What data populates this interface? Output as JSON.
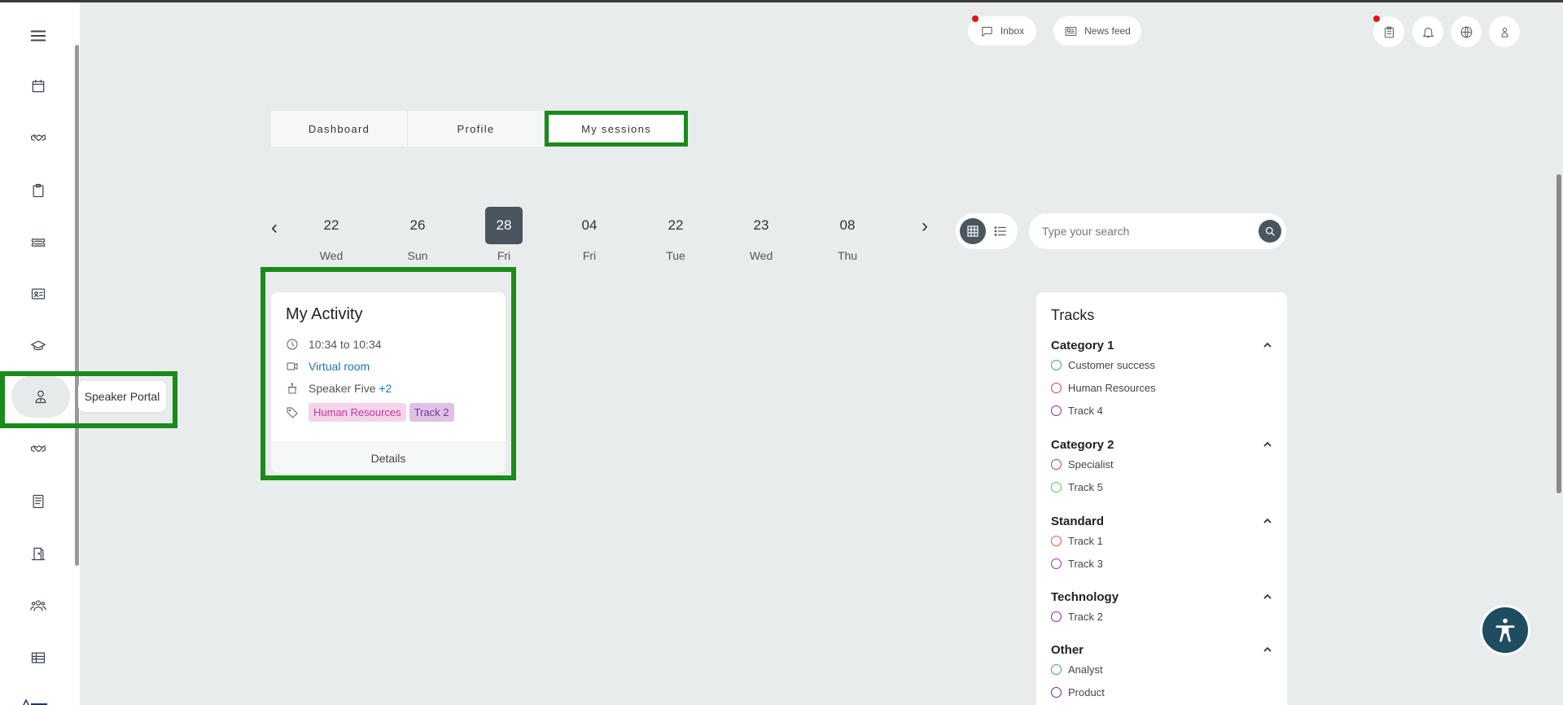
{
  "header": {
    "inbox_label": "Inbox",
    "newsfeed_label": "News feed"
  },
  "sidebar": {
    "items": [
      {
        "icon": "menu-icon"
      },
      {
        "icon": "calendar-icon"
      },
      {
        "icon": "handshake-icon"
      },
      {
        "icon": "clipboard-icon"
      },
      {
        "icon": "ticket-icon"
      },
      {
        "icon": "id-card-icon"
      },
      {
        "icon": "graduation-cap-icon"
      },
      {
        "icon": "speaker-icon",
        "active": true
      },
      {
        "icon": "handshake-icon"
      },
      {
        "icon": "book-icon"
      },
      {
        "icon": "door-icon"
      },
      {
        "icon": "group-icon"
      },
      {
        "icon": "table-icon"
      }
    ],
    "tooltip": "Speaker Portal"
  },
  "tabs": [
    {
      "label": "Dashboard"
    },
    {
      "label": "Profile"
    },
    {
      "label": "My sessions",
      "active": true
    }
  ],
  "dates": [
    {
      "num": "22",
      "day": "Wed"
    },
    {
      "num": "26",
      "day": "Sun"
    },
    {
      "num": "28",
      "day": "Fri",
      "active": true
    },
    {
      "num": "04",
      "day": "Fri"
    },
    {
      "num": "22",
      "day": "Tue"
    },
    {
      "num": "23",
      "day": "Wed"
    },
    {
      "num": "08",
      "day": "Thu"
    }
  ],
  "search": {
    "placeholder": "Type your search"
  },
  "activity": {
    "title": "My Activity",
    "time": "10:34 to 10:34",
    "location": "Virtual room",
    "speaker": "Speaker Five",
    "speaker_extra": "+2",
    "tags": [
      "Human Resources",
      "Track 2"
    ],
    "footer": "Details"
  },
  "tracks": {
    "title": "Tracks",
    "categories": [
      {
        "name": "Category 1",
        "items": [
          {
            "label": "Customer success",
            "color": "#3cb043"
          },
          {
            "label": "Human Resources",
            "color": "#c23a95"
          },
          {
            "label": "Track 4",
            "color": "#7a3294"
          }
        ]
      },
      {
        "name": "Category 2",
        "items": [
          {
            "label": "Specialist",
            "color": "#b03ab0"
          },
          {
            "label": "Track 5",
            "color": "#5cc25c"
          }
        ]
      },
      {
        "name": "Standard",
        "items": [
          {
            "label": "Track 1",
            "color": "#e05050"
          },
          {
            "label": "Track 3",
            "color": "#8a3a9a"
          }
        ]
      },
      {
        "name": "Technology",
        "items": [
          {
            "label": "Track 2",
            "color": "#7a3294"
          }
        ]
      },
      {
        "name": "Other",
        "items": [
          {
            "label": "Analyst",
            "color": "#3cb043"
          },
          {
            "label": "Product",
            "color": "#6a2a7a"
          }
        ]
      }
    ]
  },
  "colors": {
    "highlight": "#1a8a1a",
    "accent": "#4a5560",
    "notification": "#e0131a"
  }
}
